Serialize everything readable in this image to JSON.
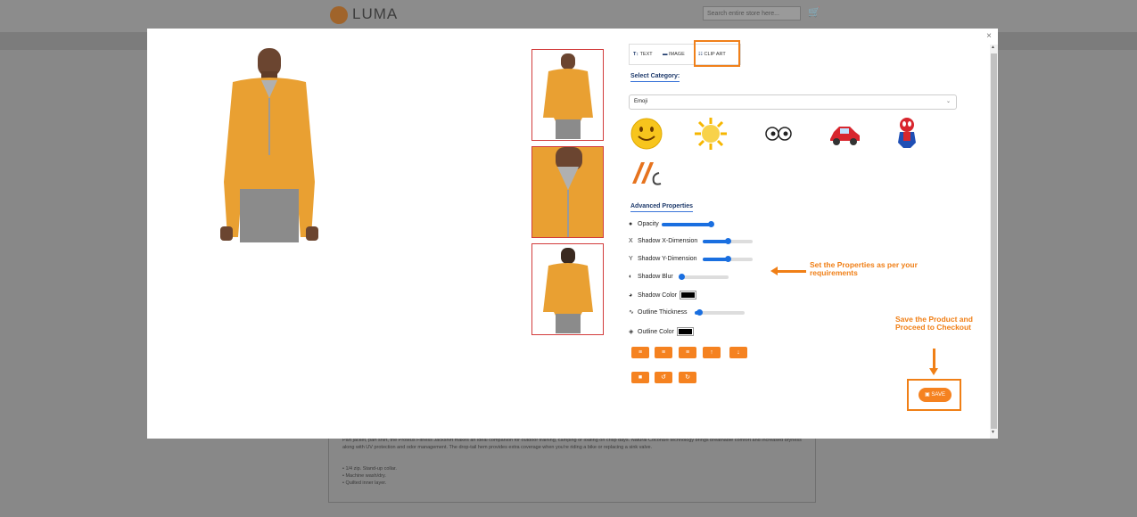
{
  "background": {
    "logo_text": "LUMA",
    "search_placeholder": "Search entire store here...",
    "description": "Part jacket, part shirt, the Proteus Fitness Jackshirt makes an ideal companion for outdoor training, camping or loafing on crisp days. Natural Cocona® technology brings breathable comfort and increased dryness along with UV protection and odor management. The drop-tail hem provides extra coverage when you're riding a bike or replacing a sink valve.",
    "features": [
      "• 1/4 zip. Stand-up collar.",
      "• Machine wash/dry.",
      "• Quilted inner layer."
    ]
  },
  "modal": {
    "close_label": "×",
    "tabs": [
      {
        "icon": "text-icon",
        "label": "TEXT"
      },
      {
        "icon": "image-icon",
        "label": "IMAGE"
      },
      {
        "icon": "clipart-icon",
        "label": "CLIP ART"
      }
    ],
    "select_category_title": "Select Category:",
    "category_value": "Emoji",
    "cliparts": [
      "smiley-face-clipart",
      "sun-clipart",
      "eyes-clipart",
      "car-clipart",
      "spiderman-clipart",
      "logo-clipart"
    ],
    "advanced_title": "Advanced Properties",
    "properties": {
      "opacity": {
        "label": "Opacity",
        "value": 1.0
      },
      "shadow_x": {
        "label": "Shadow X-Dimension",
        "value": 0.5
      },
      "shadow_y": {
        "label": "Shadow Y-Dimension",
        "value": 0.5
      },
      "shadow_blur": {
        "label": "Shadow Blur",
        "value": 0.0
      },
      "shadow_color": {
        "label": "Shadow Color",
        "color": "#000000"
      },
      "outline_thickness": {
        "label": "Outline Thickness",
        "value": 0.1
      },
      "outline_color": {
        "label": "Outline Color",
        "color": "#000000"
      }
    },
    "align_buttons": [
      "align-left",
      "align-center",
      "align-right",
      "bring-forward",
      "send-backward"
    ],
    "action_buttons": [
      "delete",
      "undo",
      "redo"
    ],
    "save_label": "SAVE"
  },
  "annotations": {
    "properties_note": "Set the Properties as per your requirements",
    "save_note": "Save the Product and Proceed to Checkout"
  },
  "colors": {
    "accent": "#f58220",
    "slider": "#1a6fe0",
    "thumb_border": "#d23b3b",
    "shirt": "#e9a032"
  }
}
